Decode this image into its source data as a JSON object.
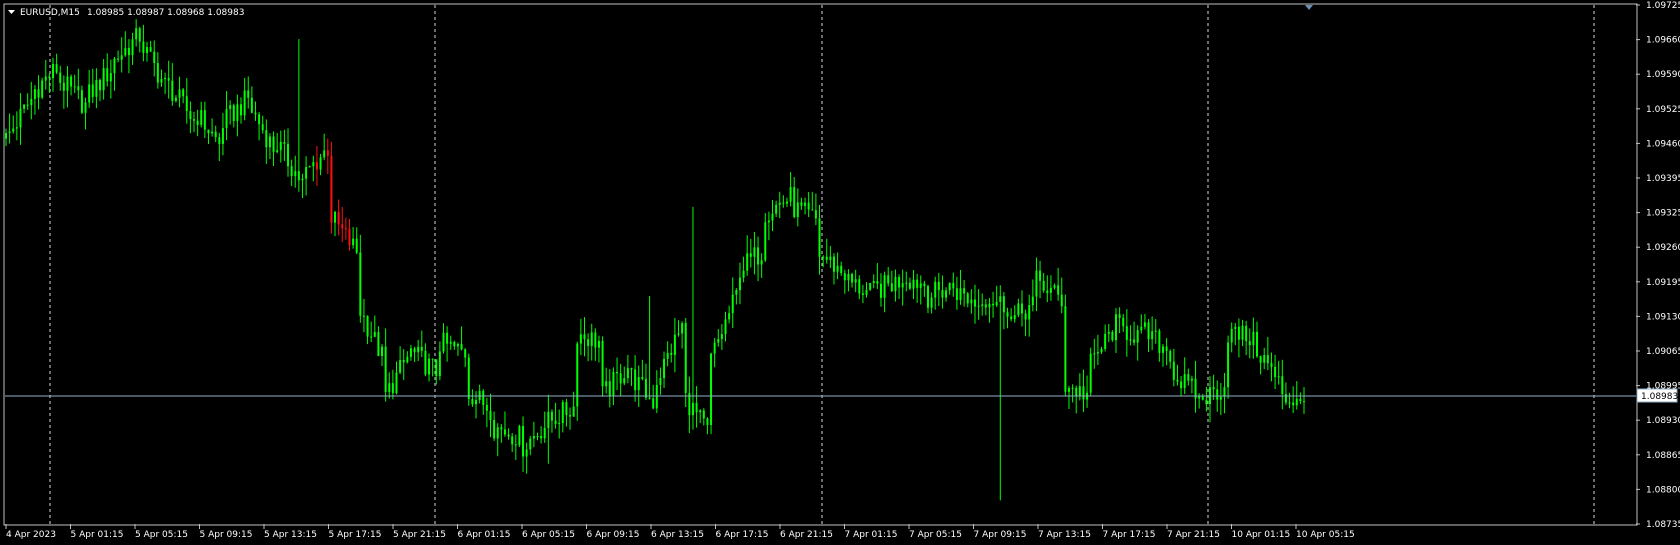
{
  "header": {
    "dropdown_icon": "triangle-down-icon",
    "symbol_label": "EURUSD,M15",
    "ohlc": "1.08985 1.08987 1.08968 1.08983"
  },
  "colors": {
    "background": "#000000",
    "frame": "#c0c0c0",
    "grid": "#d8d8d8",
    "bull": "#00ff00",
    "bear": "#ff1010",
    "bid_line": "#8fb0c8",
    "marker": "#6f8fb0"
  },
  "current_price": {
    "label": "1.08983",
    "value": 1.08983
  },
  "chart_data": {
    "type": "candlestick",
    "title": "EURUSD,M15",
    "ylim": [
      1.08735,
      1.09725
    ],
    "y_ticks": [
      "1.09725",
      "1.09660",
      "1.09590",
      "1.09525",
      "1.09460",
      "1.09395",
      "1.09325",
      "1.09260",
      "1.09195",
      "1.09130",
      "1.09065",
      "1.08995",
      "1.08930",
      "1.08865",
      "1.08800",
      "1.08735"
    ],
    "x_ticks": [
      "4 Apr 2023",
      "5 Apr 01:15",
      "5 Apr 05:15",
      "5 Apr 09:15",
      "5 Apr 13:15",
      "5 Apr 17:15",
      "5 Apr 21:15",
      "6 Apr 01:15",
      "6 Apr 05:15",
      "6 Apr 09:15",
      "6 Apr 13:15",
      "6 Apr 17:15",
      "6 Apr 21:15",
      "7 Apr 01:15",
      "7 Apr 05:15",
      "7 Apr 09:15",
      "7 Apr 13:15",
      "7 Apr 17:15",
      "7 Apr 21:15",
      "10 Apr 01:15",
      "10 Apr 05:15"
    ],
    "grid": "vertical dashed at 3 day-separator ticks plus chart end",
    "close_path": [
      [
        1.0947,
        1.0955
      ],
      [
        1.0956,
        1.0961
      ],
      [
        1.0958,
        1.0953
      ],
      [
        1.0955,
        1.0961
      ],
      [
        1.0962,
        1.0967
      ],
      [
        1.0965,
        1.0956
      ],
      [
        1.0957,
        1.095
      ],
      [
        1.0952,
        1.0945
      ],
      [
        1.095,
        1.0955
      ],
      [
        1.0953,
        1.0944
      ],
      [
        1.0946,
        1.0938
      ],
      [
        1.094,
        1.0946
      ],
      [
        1.0932,
        1.0925
      ],
      [
        1.0915,
        1.0904
      ],
      [
        1.0898,
        1.0907
      ],
      [
        1.0906,
        1.0902
      ],
      [
        1.0908,
        1.0906
      ],
      [
        1.0899,
        1.0895
      ],
      [
        1.0892,
        1.089
      ],
      [
        1.0888,
        1.0893
      ],
      [
        1.0893,
        1.0896
      ],
      [
        1.091,
        1.0908
      ],
      [
        1.0898,
        1.0904
      ],
      [
        1.0902,
        1.0896
      ],
      [
        1.0901,
        1.0912
      ],
      [
        1.0898,
        1.089
      ],
      [
        1.0905,
        1.0918
      ],
      [
        1.0922,
        1.0926
      ],
      [
        1.0933,
        1.0936
      ],
      [
        1.0934,
        1.0931
      ],
      [
        1.0925,
        1.0921
      ],
      [
        1.092,
        1.0917
      ],
      [
        1.0918,
        1.092
      ],
      [
        1.0921,
        1.0919
      ],
      [
        1.0917,
        1.0919
      ],
      [
        1.0918,
        1.0915
      ],
      [
        1.0917,
        1.0915
      ],
      [
        1.0912,
        1.0916
      ],
      [
        1.092,
        1.0916
      ],
      [
        1.09,
        1.0898
      ],
      [
        1.0904,
        1.0912
      ],
      [
        1.0911,
        1.0909
      ],
      [
        1.091,
        1.0906
      ],
      [
        1.0902,
        1.0898
      ],
      [
        1.0897,
        1.09
      ],
      [
        1.091,
        1.0909
      ],
      [
        1.0908,
        1.09
      ],
      [
        1.0897,
        1.0898
      ]
    ]
  }
}
